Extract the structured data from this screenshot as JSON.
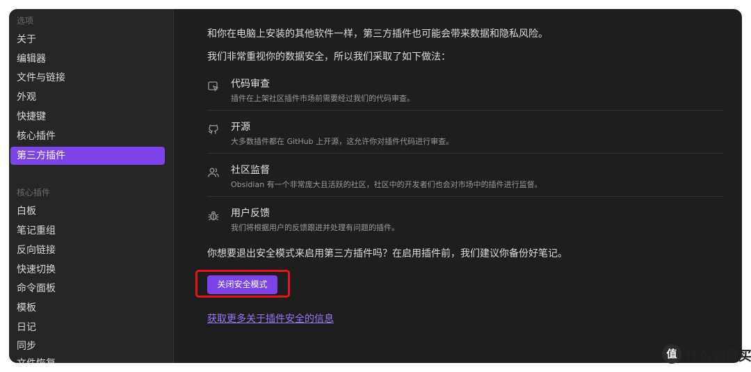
{
  "sidebar": {
    "options_title": "选项",
    "options": [
      "关于",
      "编辑器",
      "文件与链接",
      "外观",
      "快捷键",
      "核心插件",
      "第三方插件"
    ],
    "active_index": 6,
    "core_title": "核心插件",
    "core_plugins": [
      "白板",
      "笔记重组",
      "反向链接",
      "快速切换",
      "命令面板",
      "模板",
      "日记",
      "同步"
    ],
    "partial_item": "文件恢复"
  },
  "main": {
    "intro1": "和你在电脑上安装的其他软件一样，第三方插件也可能会带来数据和隐私风险。",
    "intro2": "我们非常重视你的数据安全，所以我们采取了如下做法：",
    "features": [
      {
        "icon": "code-review-icon",
        "title": "代码审查",
        "desc": "插件在上架社区插件市场前需要经过我们的代码审查。"
      },
      {
        "icon": "github-icon",
        "title": "开源",
        "desc": "大多数插件都在 GitHub 上开源，这允许你对插件代码进行审查。"
      },
      {
        "icon": "users-icon",
        "title": "社区监督",
        "desc": "Obsidian 有一个非常庞大且活跃的社区，社区中的开发者们也会对市场中的插件进行监督。"
      },
      {
        "icon": "bug-icon",
        "title": "用户反馈",
        "desc": "我们将根据用户的反馈跟进并处理有问题的插件。"
      }
    ],
    "prompt": "你想要退出安全模式来启用第三方插件吗？在启用插件前，我们建议你备份好笔记。",
    "button_label": "关闭安全模式",
    "more_link": "获取更多关于插件安全的信息"
  },
  "watermark": {
    "text": "什么值得买",
    "logo": "值"
  },
  "colors": {
    "accent": "#7b43e8",
    "highlight": "#e8151f",
    "link": "#9c76f0"
  }
}
